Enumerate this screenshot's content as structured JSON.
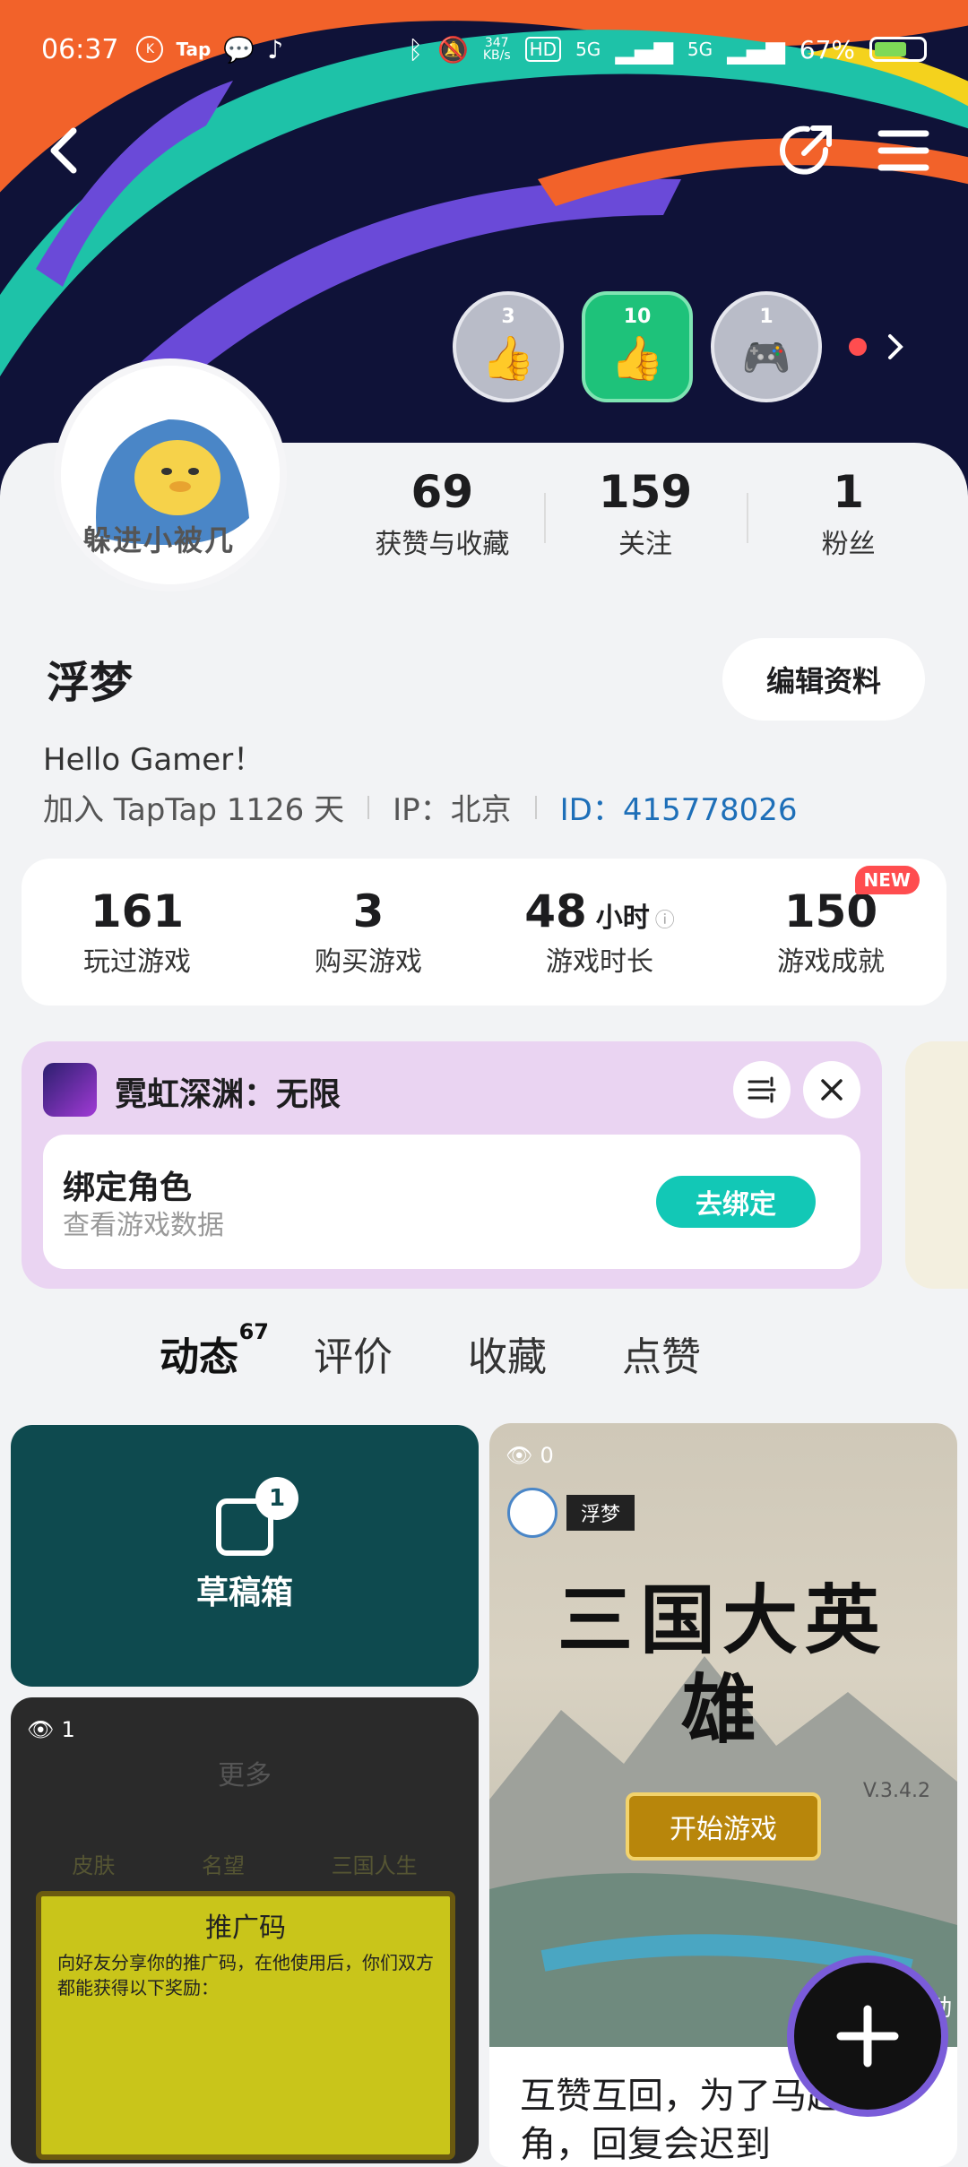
{
  "status_bar": {
    "time": "06:37",
    "net_speed_value": "347",
    "net_speed_unit": "KB/s",
    "hd": "HD",
    "signal1": "5G",
    "signal2": "5G",
    "battery": "67%",
    "battery_level": 0.67
  },
  "header": {
    "back_icon": "back-arrow-icon",
    "share_icon": "share-icon",
    "menu_icon": "menu-icon"
  },
  "badges": [
    {
      "count": "3"
    },
    {
      "count": "10"
    },
    {
      "count": "1"
    }
  ],
  "profile": {
    "avatar_text": "躲进小被几",
    "stats": [
      {
        "value": "69",
        "label": "获赞与收藏"
      },
      {
        "value": "159",
        "label": "关注"
      },
      {
        "value": "1",
        "label": "粉丝"
      }
    ],
    "name": "浮梦",
    "edit_label": "编辑资料",
    "bio": "Hello Gamer！",
    "joined": "加入 TapTap 1126 天",
    "ip": "IP：北京",
    "id": "ID：415778026"
  },
  "game_stats": [
    {
      "value": "161",
      "unit": "",
      "label": "玩过游戏"
    },
    {
      "value": "3",
      "unit": "",
      "label": "购买游戏"
    },
    {
      "value": "48",
      "unit": "小时",
      "label": "游戏时长"
    },
    {
      "value": "150",
      "unit": "",
      "label": "游戏成就",
      "tag": "NEW"
    }
  ],
  "bind_card": {
    "game_name": "霓虹深渊：无限",
    "title": "绑定角色",
    "subtitle": "查看游戏数据",
    "button": "去绑定"
  },
  "tabs": [
    {
      "label": "动态",
      "count": "67"
    },
    {
      "label": "评价"
    },
    {
      "label": "收藏"
    },
    {
      "label": "点赞"
    }
  ],
  "feed": {
    "draft_label": "草稿箱",
    "draft_count": "1",
    "post1": {
      "views": "1",
      "menu_title": "更多",
      "items": [
        "皮肤",
        "名望",
        "三国人生"
      ],
      "promo_title": "推广码",
      "promo_text": "向好友分享你的推广码，在他使用后，你们双方都能获得以下奖励："
    },
    "post2": {
      "views": "0",
      "author": "浮梦",
      "game_title": "三国大英雄",
      "version": "V.3.4.2",
      "start": "开始游戏",
      "side": "动",
      "title": "互赞互回，为了马超张角，回复会迟到"
    }
  }
}
